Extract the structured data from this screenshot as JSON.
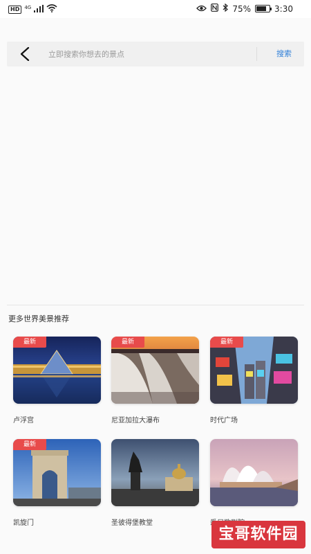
{
  "status_bar": {
    "network_badge": "HD",
    "network_type": "4G",
    "battery_percent": "75%",
    "battery_level": 0.75,
    "time": "3:30"
  },
  "search": {
    "placeholder": "立即搜索你想去的景点",
    "button_label": "搜索"
  },
  "recommend": {
    "title": "更多世界美景推荐",
    "cards": [
      {
        "label": "卢浮宫",
        "badge": "最新"
      },
      {
        "label": "尼亚加拉大瀑布",
        "badge": "最新"
      },
      {
        "label": "时代广场",
        "badge": "最新"
      },
      {
        "label": "凯旋门",
        "badge": "最新"
      },
      {
        "label": "圣彼得堡教堂",
        "badge": ""
      },
      {
        "label": "悉尼歌剧院",
        "badge": ""
      }
    ]
  },
  "watermark": "宝哥软件园"
}
